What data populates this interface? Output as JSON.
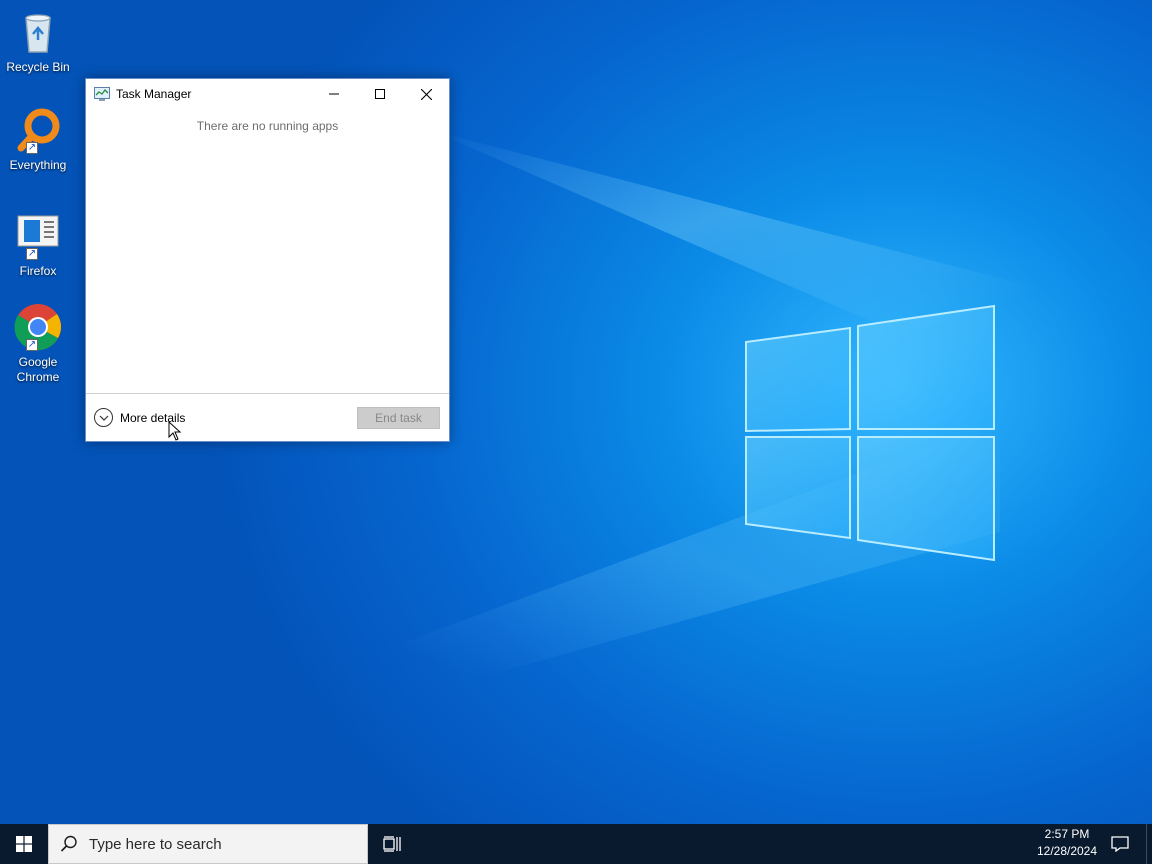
{
  "desktop": {
    "icons": [
      {
        "label": "Recycle Bin",
        "icon": "recycle-bin-icon"
      },
      {
        "label": "Everything",
        "icon": "everything-search-icon"
      },
      {
        "label": "Firefox",
        "icon": "firefox-icon"
      },
      {
        "label": "Google Chrome",
        "icon": "chrome-icon"
      }
    ]
  },
  "task_manager": {
    "title": "Task Manager",
    "empty_message": "There are no running apps",
    "more_details_label": "More details",
    "end_task_label": "End task",
    "end_task_enabled": false
  },
  "taskbar": {
    "search_placeholder": "Type here to search",
    "time": "2:57 PM",
    "date": "12/28/2024"
  },
  "colors": {
    "accent": "#0a8ae6",
    "taskbar": "#0a1a2e"
  }
}
